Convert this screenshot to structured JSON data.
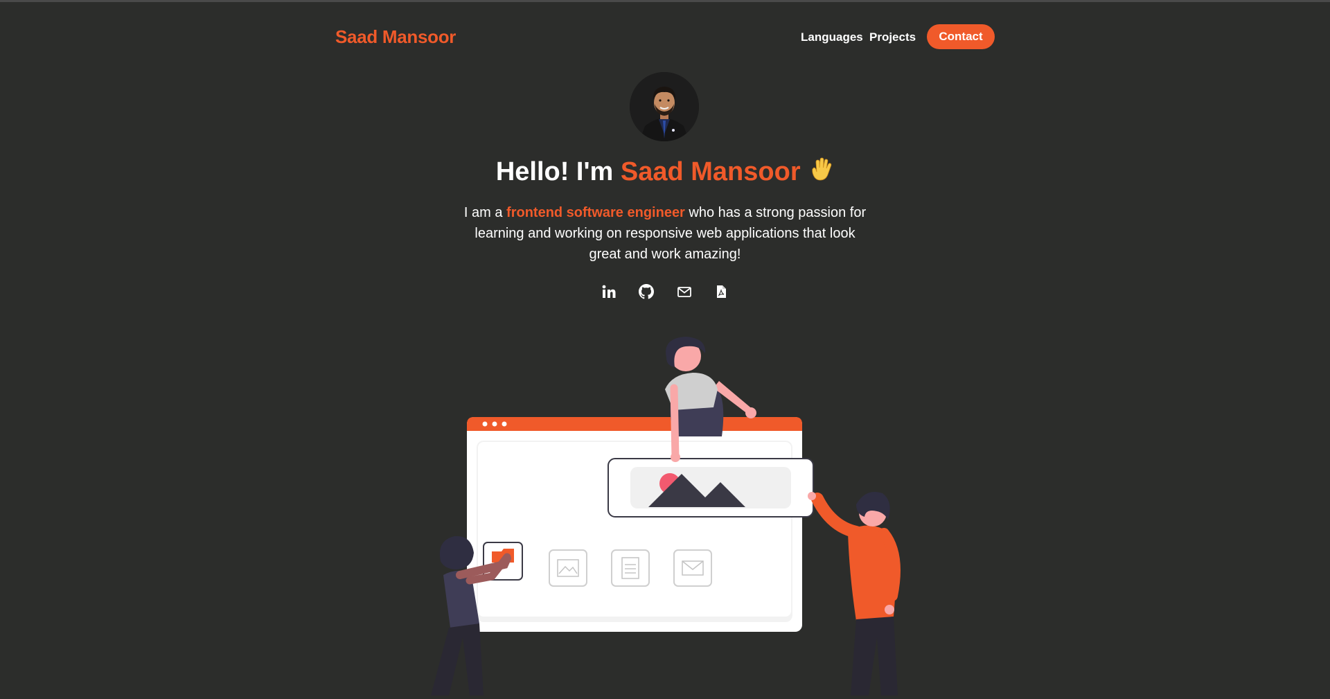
{
  "nav": {
    "brand": "Saad Mansoor",
    "links": [
      {
        "label": "Languages"
      },
      {
        "label": "Projects"
      }
    ],
    "contact_label": "Contact"
  },
  "hero": {
    "title_prefix": "Hello! I'm ",
    "title_name": "Saad Mansoor",
    "title_emoji": "🖐",
    "intro_prefix": "I am a ",
    "intro_highlight": "frontend software engineer",
    "intro_suffix": " who has a strong passion for learning and working on responsive web applications that look great and work amazing!"
  },
  "socials": [
    {
      "icon": "linkedin-icon"
    },
    {
      "icon": "github-icon"
    },
    {
      "icon": "email-icon"
    },
    {
      "icon": "pdf-resume-icon"
    }
  ],
  "colors": {
    "background": "#2c2d2b",
    "accent": "#f05a2a",
    "text": "#ffffff"
  }
}
